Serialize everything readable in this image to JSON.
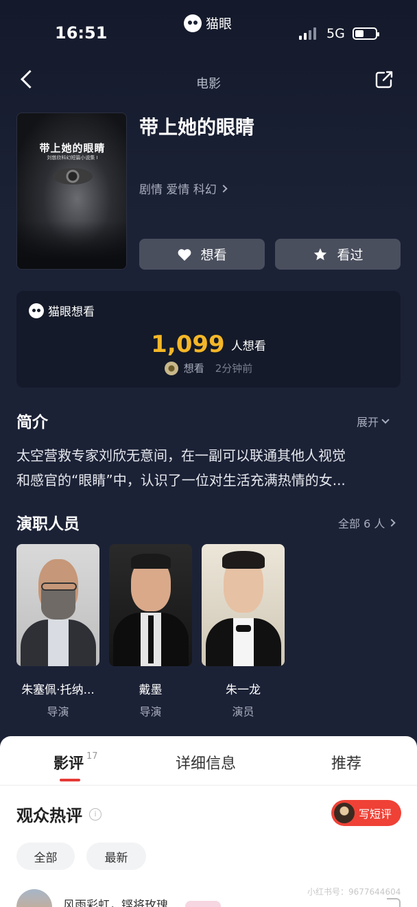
{
  "status_bar": {
    "time": "16:51",
    "network": "5G",
    "app_name": "猫眼"
  },
  "nav": {
    "title": "电影"
  },
  "movie": {
    "title": "带上她的眼睛",
    "genres": "剧情 爱情 科幻",
    "poster_title": "带上她的眼睛",
    "poster_subtitle": "刘慈欣科幻短篇小说集 I"
  },
  "actions": {
    "want_label": "想看",
    "seen_label": "看过"
  },
  "want_card": {
    "header": "猫眼想看",
    "count": "1,099",
    "count_unit": "人想看",
    "recent_action": "想看",
    "recent_time": "2分钟前"
  },
  "synopsis": {
    "title": "简介",
    "expand_label": "展开",
    "line1": "太空营救专家刘欣无意间，在一副可以联通其他人视觉",
    "line2": "和感官的“眼睛”中，认识了一位对生活充满热情的女..."
  },
  "cast": {
    "title": "演职人员",
    "all_label": "全部 6 人",
    "members": [
      {
        "name": "朱塞佩·托纳...",
        "role": "导演"
      },
      {
        "name": "戴墨",
        "role": "导演"
      },
      {
        "name": "朱一龙",
        "role": "演员"
      }
    ]
  },
  "tabs": {
    "reviews": "影评",
    "reviews_count": "17",
    "details": "详细信息",
    "recommend": "推荐"
  },
  "reviews": {
    "title": "观众热评",
    "write_label": "写短评",
    "filters": [
      "全部",
      "最新"
    ],
    "first_user": "风雨彩虹，铿将玫瑰"
  },
  "watermark": "小红书号：9677644604",
  "colors": {
    "background": "#1b2133",
    "accent": "#f5b728",
    "primary_red": "#ef4136"
  }
}
